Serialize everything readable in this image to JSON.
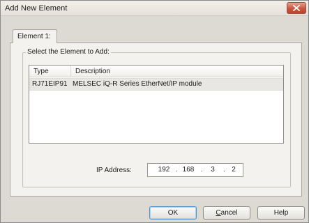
{
  "window": {
    "title": "Add New Element"
  },
  "tabs": [
    {
      "label": "Element 1:"
    }
  ],
  "group": {
    "label": "Select the Element to Add:"
  },
  "list": {
    "columns": [
      "Type",
      "Description"
    ],
    "rows": [
      {
        "type": "RJ71EIP91",
        "description": "MELSEC iQ-R Series EtherNet/IP module"
      }
    ]
  },
  "ip": {
    "label": "IP Address:",
    "octets": [
      "192",
      "168",
      "3",
      "2"
    ],
    "separator": "."
  },
  "buttons": {
    "ok": "OK",
    "cancel_first": "C",
    "cancel_rest": "ancel",
    "help": "Help"
  },
  "colors": {
    "close_button": "#c8573f",
    "selection_row": "#e9e7e3",
    "default_button_border": "#4d8fcf"
  },
  "icons": {
    "close": "close-icon"
  }
}
